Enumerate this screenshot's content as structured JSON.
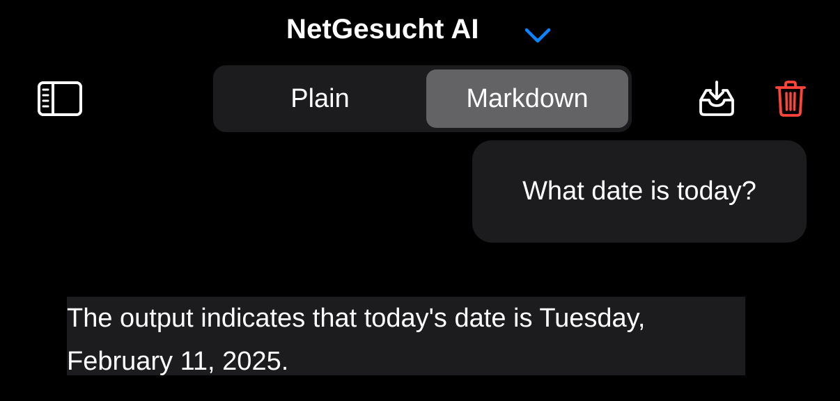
{
  "header": {
    "title": "NetGesucht AI",
    "model_menu_icon": "chevron-down-icon"
  },
  "toolbar": {
    "sidebar_icon": "sidebar-toggle-icon",
    "segments": [
      {
        "label": "Plain",
        "selected": false
      },
      {
        "label": "Markdown",
        "selected": true
      }
    ],
    "export_icon": "tray-download-icon",
    "delete_icon": "trash-icon"
  },
  "conversation": {
    "user_message": "What date is today?",
    "assistant_message": "The output indicates that today's date is Tuesday, February 11, 2025."
  },
  "colors": {
    "background": "#000000",
    "bubble": "#1c1c1e",
    "segment_selected": "#636366",
    "accent": "#0a84ff",
    "destructive": "#ff453a"
  }
}
